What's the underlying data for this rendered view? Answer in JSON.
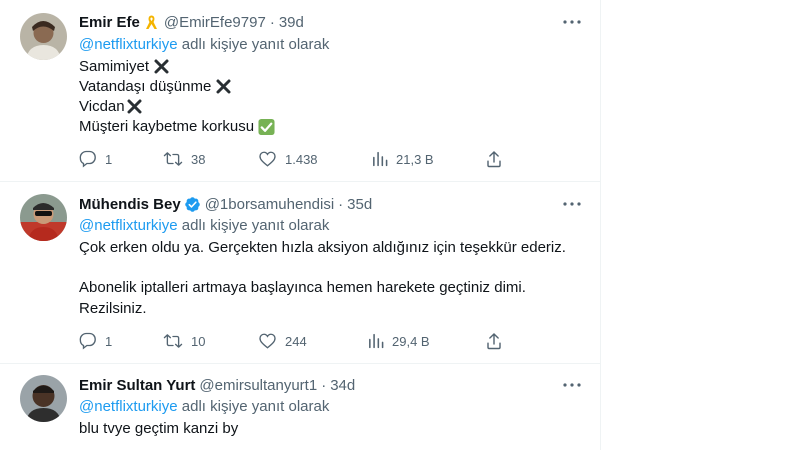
{
  "tweets": [
    {
      "name": "Emir Efe",
      "handle": "@EmirEfe9797",
      "time": "39d",
      "reply_prefix": "@netflixturkiye",
      "reply_suffix": "adlı kişiye yanıt olarak",
      "lines": [
        "Samimiyet",
        "Vatandaşı düşünme",
        "Vicdan",
        "Müşteri kaybetme korkusu"
      ],
      "stats": {
        "replies": "1",
        "retweets": "38",
        "likes": "1.438",
        "views": "21,3 B"
      }
    },
    {
      "name": "Mühendis Bey",
      "handle": "@1borsamuhendisi",
      "time": "35d",
      "reply_prefix": "@netflixturkiye",
      "reply_suffix": "adlı kişiye yanıt olarak",
      "lines": [
        "Çok erken oldu ya. Gerçekten hızla aksiyon aldığınız için teşekkür ederiz.",
        "Abonelik iptalleri artmaya başlayınca hemen harekete geçtiniz dimi.",
        "Rezilsiniz."
      ],
      "stats": {
        "replies": "1",
        "retweets": "10",
        "likes": "244",
        "views": "29,4 B"
      }
    },
    {
      "name": "Emir Sultan Yurt",
      "handle": "@emirsultanyurt1",
      "time": "34d",
      "reply_prefix": "@netflixturkiye",
      "reply_suffix": "adlı kişiye yanıt olarak",
      "lines": [
        "blu tvye geçtim kanzi by"
      ]
    }
  ],
  "dot": "·",
  "colors": {
    "link": "#1d9bf0",
    "muted": "#536471",
    "text": "#0f1419",
    "verified": "#1d9bf0"
  }
}
